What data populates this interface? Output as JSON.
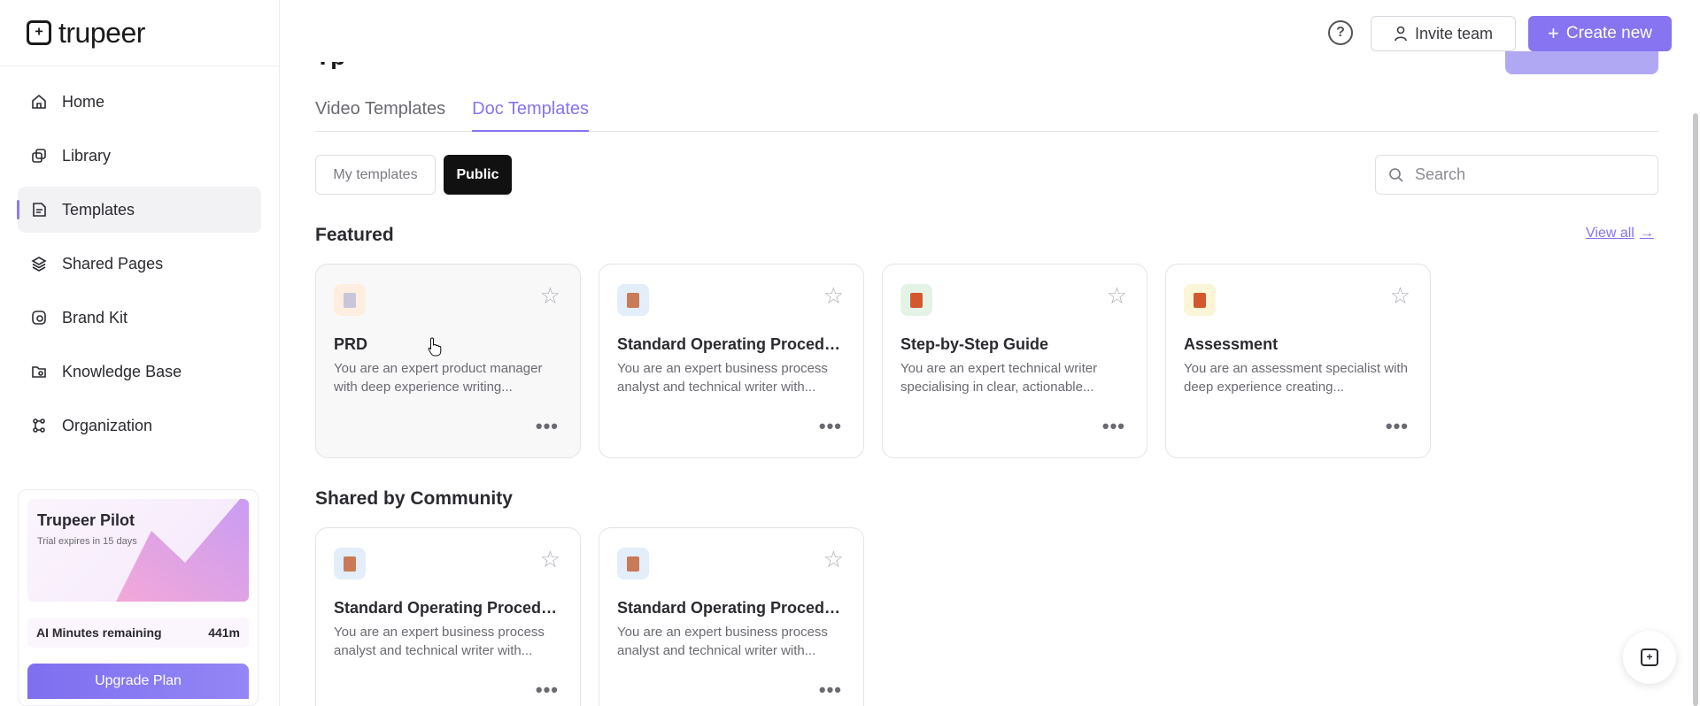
{
  "brand": {
    "name": "trupeer"
  },
  "sidebar": {
    "items": [
      {
        "label": "Home",
        "icon": "home-icon",
        "active": false
      },
      {
        "label": "Library",
        "icon": "library-icon",
        "active": false
      },
      {
        "label": "Templates",
        "icon": "templates-icon",
        "active": true
      },
      {
        "label": "Shared Pages",
        "icon": "layers-icon",
        "active": false
      },
      {
        "label": "Brand Kit",
        "icon": "brand-kit-icon",
        "active": false
      },
      {
        "label": "Knowledge Base",
        "icon": "knowledge-base-icon",
        "active": false
      },
      {
        "label": "Organization",
        "icon": "organization-icon",
        "active": false
      }
    ],
    "pilot": {
      "title": "Trupeer Pilot",
      "subtitle": "Trial expires in 15 days",
      "minutes_label": "AI Minutes remaining",
      "minutes_value": "441m",
      "upgrade_label": "Upgrade Plan"
    }
  },
  "header": {
    "help_icon": "help-circle-icon",
    "invite_label": "Invite team",
    "create_label": "Create new",
    "create_icon": "plus-icon"
  },
  "tabs": [
    {
      "label": "Video Templates",
      "active": false
    },
    {
      "label": "Doc Templates",
      "active": true
    }
  ],
  "filters": {
    "my_templates": "My templates",
    "public": "Public",
    "selected": "Public"
  },
  "search": {
    "placeholder": "Search",
    "value": ""
  },
  "featured": {
    "title": "Featured",
    "view_all": "View all",
    "cards": [
      {
        "title": "PRD",
        "desc": "You are an expert product manager with deep experience writing...",
        "icon_bg": "#fdeee0",
        "icon_fg": "#c9c6d9"
      },
      {
        "title": "Standard Operating Procedure",
        "desc": "You are an expert business process analyst and technical writer with...",
        "icon_bg": "#e3eefb",
        "icon_fg": "#c97b57"
      },
      {
        "title": "Step-by-Step Guide",
        "desc": "You are an expert technical writer specialising in clear, actionable...",
        "icon_bg": "#e4f3e6",
        "icon_fg": "#d4582e"
      },
      {
        "title": "Assessment",
        "desc": "You are an assessment specialist with deep experience creating...",
        "icon_bg": "#fdf5d8",
        "icon_fg": "#d4582e"
      }
    ]
  },
  "community": {
    "title": "Shared by Community",
    "cards": [
      {
        "title": "Standard Operating Procedu...",
        "desc": "You are an expert business process analyst and technical writer with...",
        "icon_bg": "#e3eefb",
        "icon_fg": "#c97b57"
      },
      {
        "title": "Standard Operating Procedu...",
        "desc": "You are an expert business process analyst and technical writer with...",
        "icon_bg": "#e3eefb",
        "icon_fg": "#c97b57"
      }
    ]
  },
  "colors": {
    "accent": "#8674f0",
    "text": "#2a2a30",
    "muted": "#6a6a72"
  }
}
